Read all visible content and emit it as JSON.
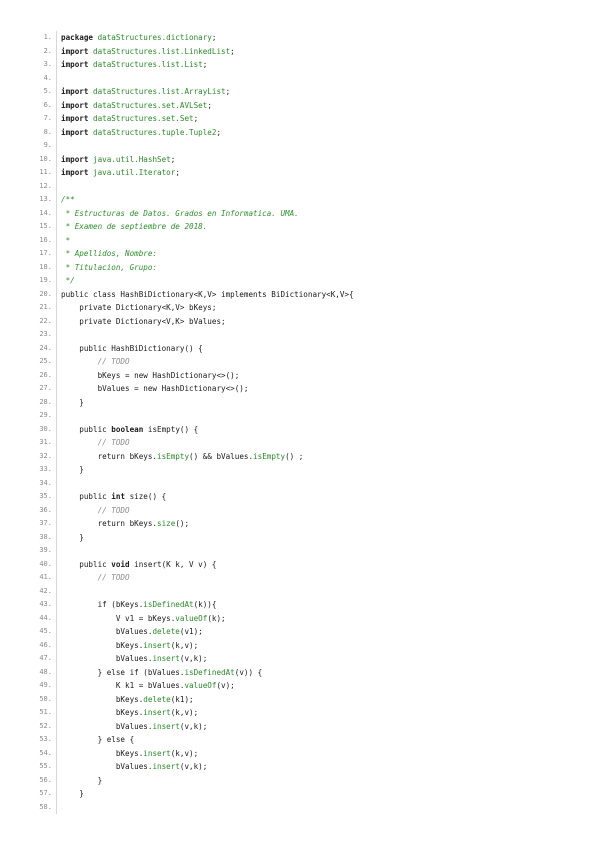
{
  "lines": [
    [
      {
        "t": "package ",
        "s": "k"
      },
      {
        "t": "dataStructures.dictionary",
        "s": "pk"
      },
      {
        "t": ";",
        "s": "p"
      }
    ],
    [
      {
        "t": "import ",
        "s": "k"
      },
      {
        "t": "dataStructures.list.LinkedList",
        "s": "pk"
      },
      {
        "t": ";",
        "s": "p"
      }
    ],
    [
      {
        "t": "import ",
        "s": "k"
      },
      {
        "t": "dataStructures.list.List",
        "s": "pk"
      },
      {
        "t": ";",
        "s": "p"
      }
    ],
    [],
    [
      {
        "t": "import ",
        "s": "k"
      },
      {
        "t": "dataStructures.list.ArrayList",
        "s": "pk"
      },
      {
        "t": ";",
        "s": "p"
      }
    ],
    [
      {
        "t": "import ",
        "s": "k"
      },
      {
        "t": "dataStructures.set.AVLSet",
        "s": "pk"
      },
      {
        "t": ";",
        "s": "p"
      }
    ],
    [
      {
        "t": "import ",
        "s": "k"
      },
      {
        "t": "dataStructures.set.Set",
        "s": "pk"
      },
      {
        "t": ";",
        "s": "p"
      }
    ],
    [
      {
        "t": "import ",
        "s": "k"
      },
      {
        "t": "dataStructures.tuple.Tuple2",
        "s": "pk"
      },
      {
        "t": ";",
        "s": "p"
      }
    ],
    [],
    [
      {
        "t": "import ",
        "s": "k"
      },
      {
        "t": "java.util.HashSet",
        "s": "pk"
      },
      {
        "t": ";",
        "s": "p"
      }
    ],
    [
      {
        "t": "import ",
        "s": "k"
      },
      {
        "t": "java.util.Iterator",
        "s": "pk"
      },
      {
        "t": ";",
        "s": "p"
      }
    ],
    [],
    [
      {
        "t": "/**",
        "s": "c"
      }
    ],
    [
      {
        "t": " * Estructuras de Datos. Grados en Informatica. UMA.",
        "s": "c"
      }
    ],
    [
      {
        "t": " * Examen de septiembre de 2018.",
        "s": "c"
      }
    ],
    [
      {
        "t": " *",
        "s": "c"
      }
    ],
    [
      {
        "t": " * Apellidos, Nombre:",
        "s": "c"
      }
    ],
    [
      {
        "t": " * Titulacion, Grupo:",
        "s": "c"
      }
    ],
    [
      {
        "t": " */",
        "s": "c"
      }
    ],
    [
      {
        "t": "public class HashBiDictionary<K,V> implements BiDictionary<K,V>{",
        "s": "p"
      }
    ],
    [
      {
        "t": "    private Dictionary<K,V> bKeys;",
        "s": "p"
      }
    ],
    [
      {
        "t": "    private Dictionary<V,K> bValues;",
        "s": "p"
      }
    ],
    [],
    [
      {
        "t": "    public HashBiDictionary() {",
        "s": "p"
      }
    ],
    [
      {
        "t": "        // TODO",
        "s": "t"
      }
    ],
    [
      {
        "t": "        bKeys = new HashDictionary<>();",
        "s": "p"
      }
    ],
    [
      {
        "t": "        bValues = new HashDictionary<>();",
        "s": "p"
      }
    ],
    [
      {
        "t": "    }",
        "s": "p"
      }
    ],
    [],
    [
      {
        "t": "    public ",
        "s": "p"
      },
      {
        "t": "boolean",
        "s": "k"
      },
      {
        "t": " isEmpty() {",
        "s": "p"
      }
    ],
    [
      {
        "t": "        // TODO",
        "s": "t"
      }
    ],
    [
      {
        "t": "        return bKeys.",
        "s": "p"
      },
      {
        "t": "isEmpty",
        "s": "m"
      },
      {
        "t": "() && bValues.",
        "s": "p"
      },
      {
        "t": "isEmpty",
        "s": "m"
      },
      {
        "t": "() ;",
        "s": "p"
      }
    ],
    [
      {
        "t": "    }",
        "s": "p"
      }
    ],
    [],
    [
      {
        "t": "    public ",
        "s": "p"
      },
      {
        "t": "int",
        "s": "k"
      },
      {
        "t": " size() {",
        "s": "p"
      }
    ],
    [
      {
        "t": "        // TODO",
        "s": "t"
      }
    ],
    [
      {
        "t": "        return bKeys.",
        "s": "p"
      },
      {
        "t": "size",
        "s": "m"
      },
      {
        "t": "();",
        "s": "p"
      }
    ],
    [
      {
        "t": "    }",
        "s": "p"
      }
    ],
    [],
    [
      {
        "t": "    public ",
        "s": "p"
      },
      {
        "t": "void",
        "s": "k"
      },
      {
        "t": " insert(K k, V v) {",
        "s": "p"
      }
    ],
    [
      {
        "t": "        // TODO",
        "s": "t"
      }
    ],
    [],
    [
      {
        "t": "        if (bKeys.",
        "s": "p"
      },
      {
        "t": "isDefinedAt",
        "s": "m"
      },
      {
        "t": "(k)){",
        "s": "p"
      }
    ],
    [
      {
        "t": "            V v1 = bKeys.",
        "s": "p"
      },
      {
        "t": "valueOf",
        "s": "m"
      },
      {
        "t": "(k);",
        "s": "p"
      }
    ],
    [
      {
        "t": "            bValues.",
        "s": "p"
      },
      {
        "t": "delete",
        "s": "m"
      },
      {
        "t": "(v1);",
        "s": "p"
      }
    ],
    [
      {
        "t": "            bKeys.",
        "s": "p"
      },
      {
        "t": "insert",
        "s": "m"
      },
      {
        "t": "(k,v);",
        "s": "p"
      }
    ],
    [
      {
        "t": "            bValues.",
        "s": "p"
      },
      {
        "t": "insert",
        "s": "m"
      },
      {
        "t": "(v,k);",
        "s": "p"
      }
    ],
    [
      {
        "t": "        } else if (bValues.",
        "s": "p"
      },
      {
        "t": "isDefinedAt",
        "s": "m"
      },
      {
        "t": "(v)) {",
        "s": "p"
      }
    ],
    [
      {
        "t": "            K k1 = bValues.",
        "s": "p"
      },
      {
        "t": "valueOf",
        "s": "m"
      },
      {
        "t": "(v);",
        "s": "p"
      }
    ],
    [
      {
        "t": "            bKeys.",
        "s": "p"
      },
      {
        "t": "delete",
        "s": "m"
      },
      {
        "t": "(k1);",
        "s": "p"
      }
    ],
    [
      {
        "t": "            bKeys.",
        "s": "p"
      },
      {
        "t": "insert",
        "s": "m"
      },
      {
        "t": "(k,v);",
        "s": "p"
      }
    ],
    [
      {
        "t": "            bValues.",
        "s": "p"
      },
      {
        "t": "insert",
        "s": "m"
      },
      {
        "t": "(v,k);",
        "s": "p"
      }
    ],
    [
      {
        "t": "        } else {",
        "s": "p"
      }
    ],
    [
      {
        "t": "            bKeys.",
        "s": "p"
      },
      {
        "t": "insert",
        "s": "m"
      },
      {
        "t": "(k,v);",
        "s": "p"
      }
    ],
    [
      {
        "t": "            bValues.",
        "s": "p"
      },
      {
        "t": "insert",
        "s": "m"
      },
      {
        "t": "(v,k);",
        "s": "p"
      }
    ],
    [
      {
        "t": "        }",
        "s": "p"
      }
    ],
    [
      {
        "t": "    }",
        "s": "p"
      }
    ],
    []
  ]
}
